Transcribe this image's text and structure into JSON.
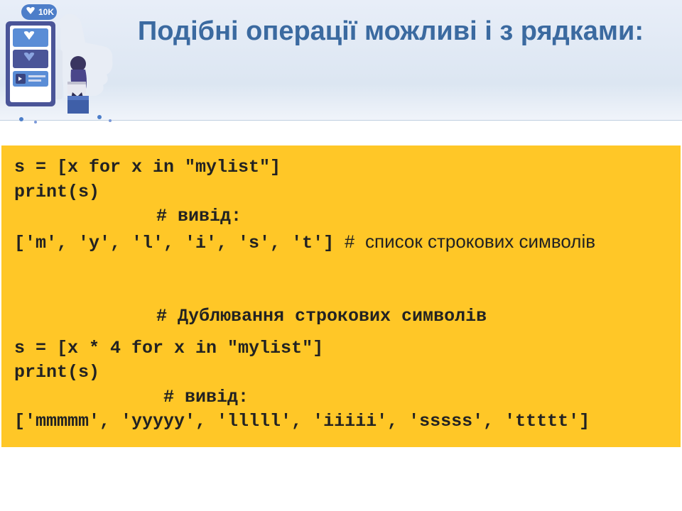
{
  "title": "Подібні операції можливі і з рядками:",
  "code": {
    "line1": "s = [x for x in \"mylist\"]",
    "line2": "print(s)",
    "line3": "# вивід:",
    "line4_code": "['m', 'y', 'l', 'i', 's', 't']",
    "line4_comment_hash": "#",
    "line4_comment": "список строкових символів",
    "line6": "# Дублювання строкових символів",
    "line7": "s = [x * 4 for x in \"mylist\"]",
    "line8": "print(s)",
    "line9": "# вивід:",
    "line10": "['mmmmm', 'yyyyy', 'lllll', 'iiiii', 'sssss', 'ttttt']"
  },
  "illustration": {
    "badge_text": "10K"
  }
}
